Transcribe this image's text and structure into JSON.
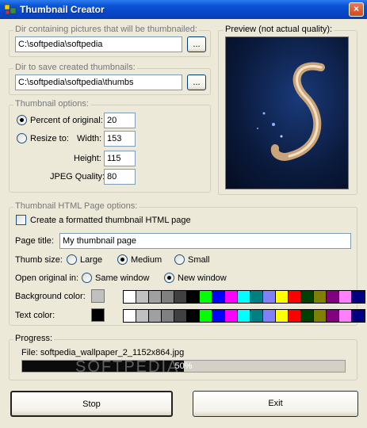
{
  "window": {
    "title": "Thumbnail Creator",
    "close_glyph": "×"
  },
  "source_dir": {
    "legend": "Dir containing pictures that will be thumbnailed:",
    "value": "C:\\softpedia\\softpedia",
    "browse_label": "..."
  },
  "dest_dir": {
    "legend": "Dir to save created thumbnails:",
    "value": "C:\\softpedia\\softpedia\\thumbs",
    "browse_label": "..."
  },
  "thumb_options": {
    "legend": "Thumbnail options:",
    "percent_label": "Percent of original:",
    "percent_value": "20",
    "percent_selected": true,
    "resize_label": "Resize to:",
    "resize_selected": false,
    "width_label": "Width:",
    "width_value": "153",
    "height_label": "Height:",
    "height_value": "115",
    "quality_label": "JPEG Quality:",
    "quality_value": "80"
  },
  "preview": {
    "legend": "Preview (not actual quality):"
  },
  "html_options": {
    "legend": "Thumbnail HTML Page options:",
    "create_label": "Create a formatted thumbnail HTML page",
    "create_checked": false,
    "page_title_label": "Page title:",
    "page_title_value": "My thumbnail page",
    "thumb_size_label": "Thumb size:",
    "thumb_size_options": [
      "Large",
      "Medium",
      "Small"
    ],
    "thumb_size_selected": "Medium",
    "open_original_label": "Open original in:",
    "open_original_options": [
      "Same window",
      "New window"
    ],
    "open_original_selected": "New window",
    "bg_color_label": "Background color:",
    "bg_color_selected": "#c0c0c0",
    "text_color_label": "Text color:",
    "text_color_selected": "#000000",
    "palette": [
      "#ffffff",
      "#c0c0c0",
      "#a0a0a0",
      "#808080",
      "#404040",
      "#000000",
      "#00ff00",
      "#0000ff",
      "#ff00ff",
      "#00ffff",
      "#008080",
      "#8080ff",
      "#ffff00",
      "#ff0000",
      "#004000",
      "#808000",
      "#800080",
      "#ff80ff",
      "#000080"
    ]
  },
  "progress": {
    "legend": "Progress:",
    "file_text": "File: softpedia_wallpaper_2_1152x864.jpg",
    "percent": 50,
    "percent_text": "50%"
  },
  "buttons": {
    "stop_label": "Stop",
    "exit_label": "Exit"
  },
  "watermark": {
    "text": "SOFTPEDIA"
  }
}
